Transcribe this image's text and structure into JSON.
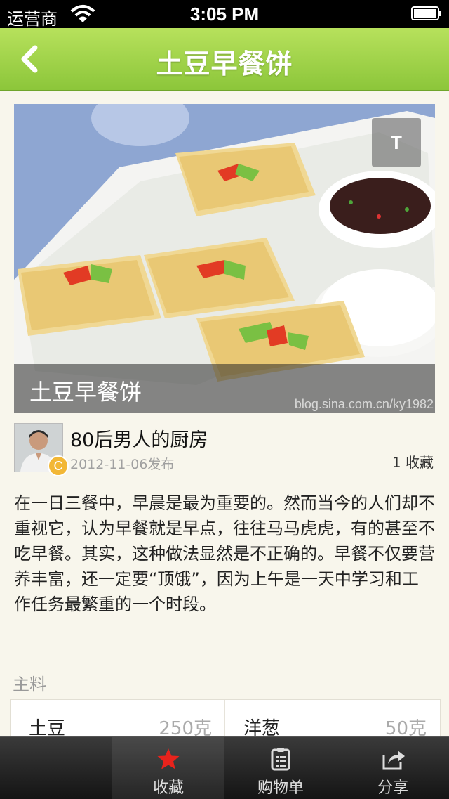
{
  "status_bar": {
    "carrier": "运营商",
    "time": "3:05 PM"
  },
  "nav": {
    "title": "土豆早餐饼"
  },
  "hero": {
    "caption": "土豆早餐饼",
    "t_button": "T",
    "watermark": "blog.sina.com.cn/ky1982"
  },
  "author": {
    "name": "80后男人的厨房",
    "badge": "C",
    "date": "2012-11-06发布",
    "favorites": "1 收藏"
  },
  "description": "在一日三餐中，早晨是最为重要的。然而当今的人们却不重视它，认为早餐就是早点，往往马马虎虎，有的甚至不吃早餐。其实，这种做法显然是不正确的。早餐不仅要营养丰富，还一定要“顶饿”，因为上午是一天中学习和工作任务最繁重的一个时段。",
  "ingredients": {
    "label": "主料",
    "items": [
      {
        "name": "土豆",
        "amount": "250克"
      },
      {
        "name": "洋葱",
        "amount": "50克"
      }
    ]
  },
  "tabbar": {
    "items": [
      {
        "label": "",
        "icon": ""
      },
      {
        "label": "收藏",
        "icon": "star-icon"
      },
      {
        "label": "购物单",
        "icon": "clipboard-icon"
      },
      {
        "label": "分享",
        "icon": "share-icon"
      }
    ]
  },
  "colors": {
    "nav_green": "#9fd44a",
    "star_red": "#e8231c"
  }
}
